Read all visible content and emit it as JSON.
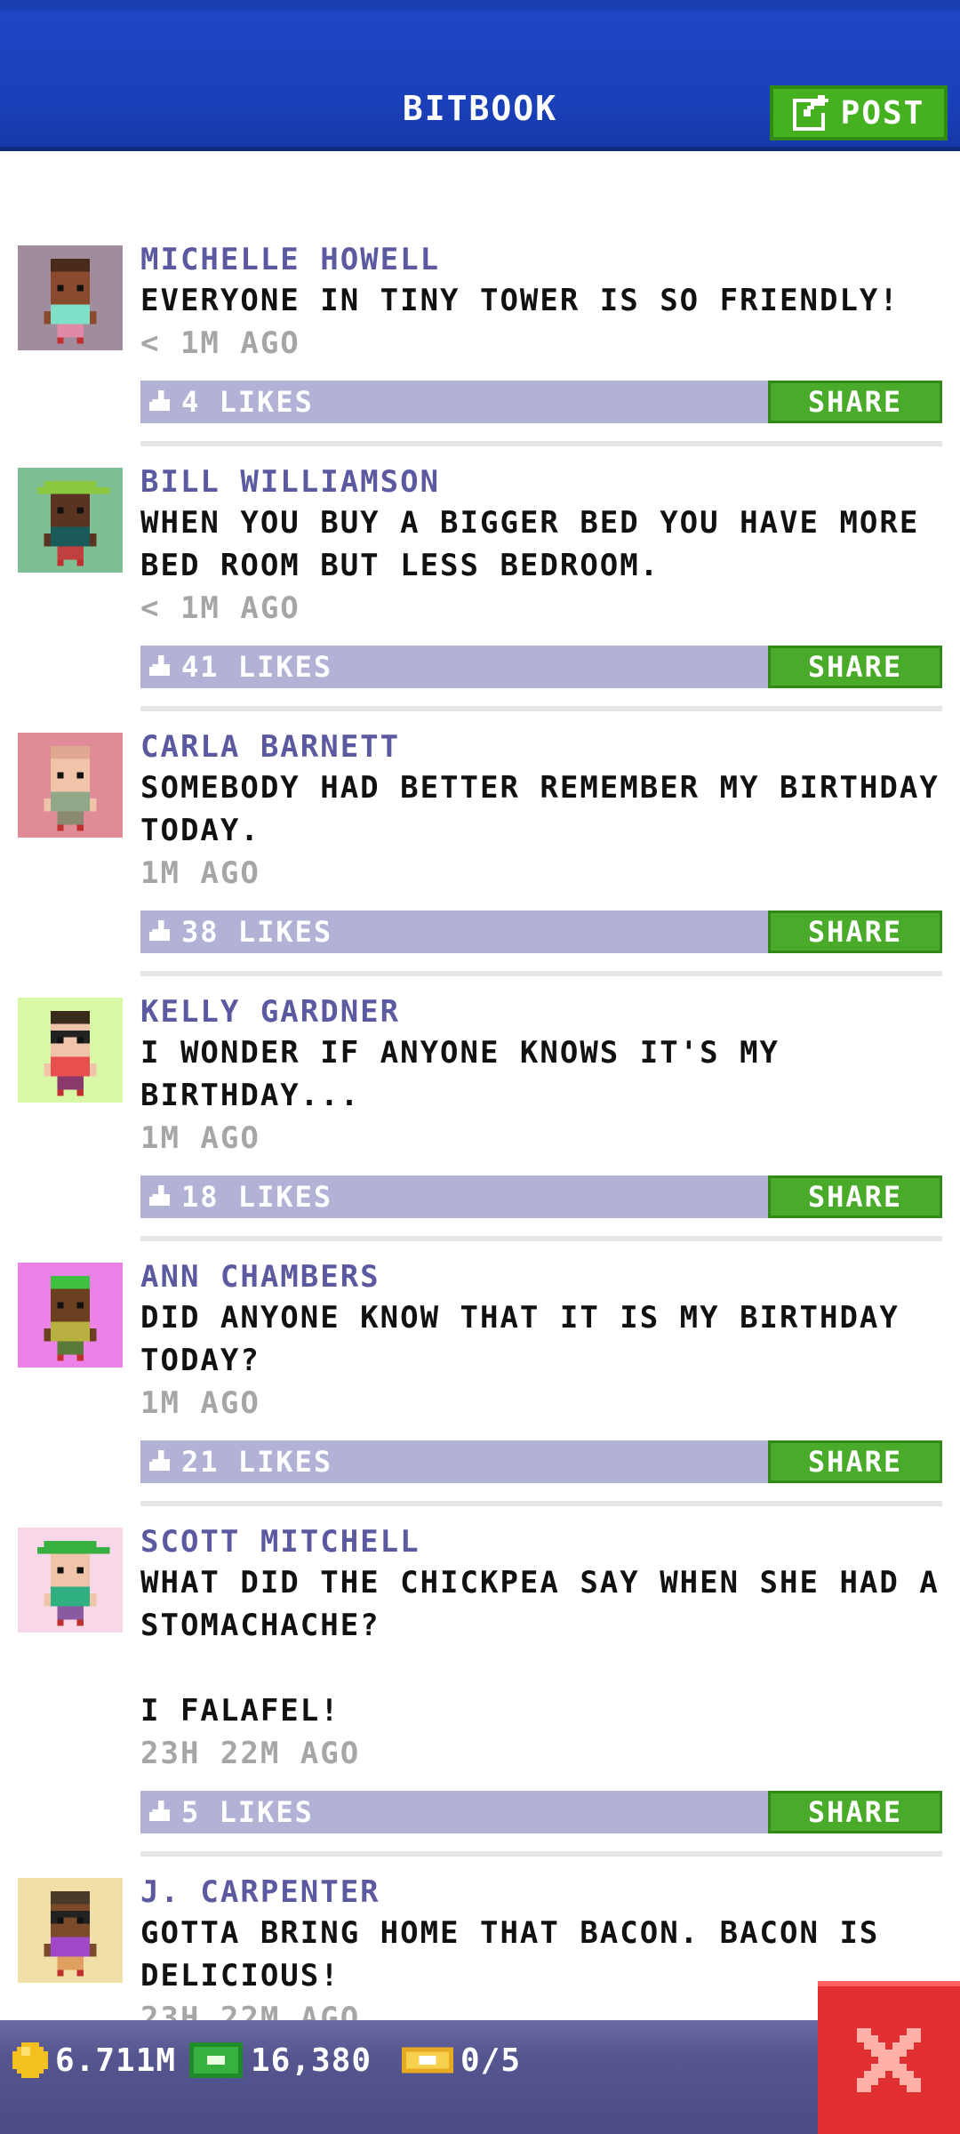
{
  "header": {
    "title": "BITBOOK",
    "post_label": "POST"
  },
  "posts": [
    {
      "author": "MICHELLE HOWELL",
      "text": "EVERYONE IN TINY TOWER IS SO FRIENDLY!",
      "time": "< 1M AGO",
      "likes": "4 LIKES",
      "share": "SHARE",
      "avatar": {
        "bg": "#a08c9c",
        "skin": "#8a4a2e",
        "hair": "#4a2a1a",
        "shirt": "#7fe0c8",
        "pants": "#e08aa8",
        "hat": null,
        "glasses": false
      }
    },
    {
      "author": "BILL WILLIAMSON",
      "text": "WHEN YOU BUY A BIGGER BED YOU HAVE MORE BED ROOM BUT LESS BEDROOM.",
      "time": "< 1M AGO",
      "likes": "41 LIKES",
      "share": "SHARE",
      "avatar": {
        "bg": "#7fbf94",
        "skin": "#5a3420",
        "hair": "#222222",
        "shirt": "#1a5a5a",
        "pants": "#c04040",
        "hat": "#8ac840",
        "glasses": false
      }
    },
    {
      "author": "CARLA BARNETT",
      "text": "SOMEBODY HAD BETTER REMEMBER MY BIRTHDAY TODAY.",
      "time": "1M AGO",
      "likes": "38 LIKES",
      "share": "SHARE",
      "avatar": {
        "bg": "#e08c98",
        "skin": "#f0c4a8",
        "hair": "#e0a890",
        "shirt": "#90a888",
        "pants": "#8a8a70",
        "hat": null,
        "glasses": false
      }
    },
    {
      "author": "KELLY GARDNER",
      "text": "I WONDER IF ANYONE KNOWS IT'S MY BIRTHDAY...",
      "time": "1M AGO",
      "likes": "18 LIKES",
      "share": "SHARE",
      "avatar": {
        "bg": "#d8f8a8",
        "skin": "#f0c4a8",
        "hair": "#3a2a1a",
        "shirt": "#e85050",
        "pants": "#8a3a6a",
        "hat": null,
        "glasses": true
      }
    },
    {
      "author": "ANN CHAMBERS",
      "text": "DID ANYONE KNOW THAT IT IS MY BIRTHDAY TODAY?",
      "time": "1M AGO",
      "likes": "21 LIKES",
      "share": "SHARE",
      "avatar": {
        "bg": "#ec82e8",
        "skin": "#6a4020",
        "hair": "#40c040",
        "shirt": "#b8b040",
        "pants": "#5a7a3a",
        "hat": null,
        "glasses": false
      }
    },
    {
      "author": "SCOTT MITCHELL",
      "text": "WHAT DID THE CHICKPEA SAY WHEN SHE HAD A STOMACHACHE?\n\nI FALAFEL!",
      "time": "23H 22M AGO",
      "likes": "5 LIKES",
      "share": "SHARE",
      "avatar": {
        "bg": "#f8d8e8",
        "skin": "#f0c4a8",
        "hair": "#3a2a1a",
        "shirt": "#30b080",
        "pants": "#8a5aa0",
        "hat": "#38b040",
        "glasses": false
      }
    },
    {
      "author": "J. CARPENTER",
      "text": "GOTTA BRING HOME THAT BACON. BACON IS DELICIOUS!",
      "time": "23H 22M AGO",
      "likes": "",
      "share": "",
      "avatar": {
        "bg": "#f0e0a8",
        "skin": "#7a4a2a",
        "hair": "#4a3a2a",
        "shirt": "#a048c8",
        "pants": "#e0a060",
        "hat": null,
        "glasses": true
      }
    }
  ],
  "bottom": {
    "coins": "6.711M",
    "bux": "16,380",
    "tickets": "0/5"
  },
  "icons": {
    "post": "edit-icon",
    "like": "thumbs-up-icon",
    "coin": "coin-icon",
    "bux": "bux-icon",
    "ticket": "ticket-icon",
    "close": "close-icon"
  }
}
